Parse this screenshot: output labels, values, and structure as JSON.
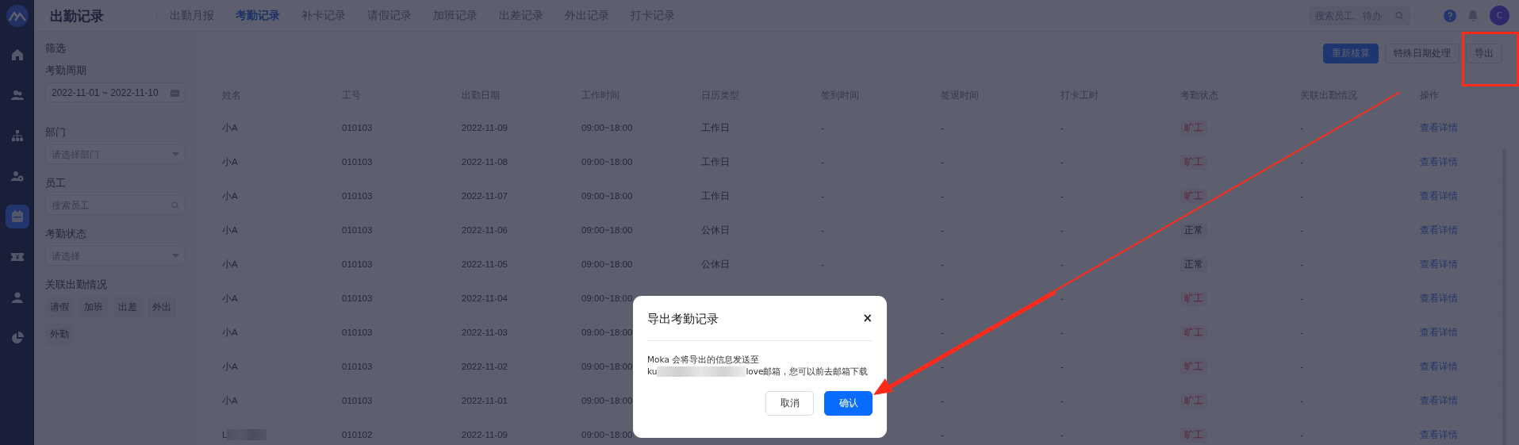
{
  "app": {
    "title": "出勤记录"
  },
  "nav_tabs": [
    {
      "label": "出勤月报",
      "selected": false
    },
    {
      "label": "考勤记录",
      "selected": true
    },
    {
      "label": "补卡记录",
      "selected": false
    },
    {
      "label": "请假记录",
      "selected": false
    },
    {
      "label": "加班记录",
      "selected": false
    },
    {
      "label": "出差记录",
      "selected": false
    },
    {
      "label": "外出记录",
      "selected": false
    },
    {
      "label": "打卡记录",
      "selected": false
    }
  ],
  "header": {
    "search": {
      "placeholder": "搜索员工、待办"
    },
    "avatar": "C"
  },
  "sidebar": {
    "items": [
      {
        "kind": "home",
        "selected": false
      },
      {
        "kind": "people",
        "selected": false
      },
      {
        "kind": "org",
        "selected": false
      },
      {
        "kind": "user-gear",
        "selected": false
      },
      {
        "kind": "calendar",
        "selected": true
      },
      {
        "kind": "ticket",
        "selected": false
      },
      {
        "kind": "person",
        "selected": false
      },
      {
        "kind": "pie",
        "selected": false
      }
    ]
  },
  "filter": {
    "title": "筛选",
    "fields": [
      {
        "label": "考勤周期",
        "kind": "date",
        "value": "2022-11-01 ~ 2022-11-10"
      },
      {
        "label": "部门",
        "kind": "select",
        "placeholder": "请选择部门"
      },
      {
        "label": "员工",
        "kind": "search",
        "placeholder": "搜索员工"
      },
      {
        "label": "考勤状态",
        "kind": "select",
        "placeholder": "请选择"
      }
    ],
    "related": {
      "label": "关联出勤情况",
      "chips": [
        "请假",
        "加班",
        "出差",
        "外出",
        "外勤"
      ]
    }
  },
  "toolbar": {
    "buttons": [
      {
        "label": "重新核算",
        "kind": "primary"
      },
      {
        "label": "特殊日期处理",
        "kind": "default"
      },
      {
        "label": "导出",
        "kind": "default"
      }
    ]
  },
  "table": {
    "columns": [
      "姓名",
      "工号",
      "出勤日期",
      "工作时间",
      "日历类型",
      "签到时间",
      "签退时间",
      "打卡工时",
      "考勤状态",
      "关联出勤情况",
      "操作"
    ],
    "rows": [
      {
        "name": "小A",
        "id": "010103",
        "date": "2022-11-09",
        "hours": "09:00~18:00",
        "calendar": "工作日",
        "sign_in": "-",
        "sign_out": "-",
        "punch_hours": "-",
        "status": {
          "label": "旷工",
          "kind": "absent"
        },
        "related": "-",
        "action": "查看详情"
      },
      {
        "name": "小A",
        "id": "010103",
        "date": "2022-11-08",
        "hours": "09:00~18:00",
        "calendar": "工作日",
        "sign_in": "-",
        "sign_out": "-",
        "punch_hours": "-",
        "status": {
          "label": "旷工",
          "kind": "absent"
        },
        "related": "-",
        "action": "查看详情"
      },
      {
        "name": "小A",
        "id": "010103",
        "date": "2022-11-07",
        "hours": "09:00~18:00",
        "calendar": "工作日",
        "sign_in": "-",
        "sign_out": "-",
        "punch_hours": "-",
        "status": {
          "label": "旷工",
          "kind": "absent"
        },
        "related": "-",
        "action": "查看详情"
      },
      {
        "name": "小A",
        "id": "010103",
        "date": "2022-11-06",
        "hours": "09:00~18:00",
        "calendar": "公休日",
        "sign_in": "-",
        "sign_out": "-",
        "punch_hours": "-",
        "status": {
          "label": "正常",
          "kind": "normal"
        },
        "related": "-",
        "action": "查看详情"
      },
      {
        "name": "小A",
        "id": "010103",
        "date": "2022-11-05",
        "hours": "09:00~18:00",
        "calendar": "公休日",
        "sign_in": "-",
        "sign_out": "-",
        "punch_hours": "-",
        "status": {
          "label": "正常",
          "kind": "normal"
        },
        "related": "-",
        "action": "查看详情"
      },
      {
        "name": "小A",
        "id": "010103",
        "date": "2022-11-04",
        "hours": "09:00~18:00",
        "sign_out": "-",
        "punch_hours": "-",
        "status": {
          "label": "旷工",
          "kind": "absent"
        },
        "related": "-",
        "action": "查看详情"
      },
      {
        "name": "小A",
        "id": "010103",
        "date": "2022-11-03",
        "hours": "09:00~18:00",
        "sign_out": "-",
        "punch_hours": "-",
        "status": {
          "label": "旷工",
          "kind": "absent"
        },
        "related": "-",
        "action": "查看详情"
      },
      {
        "name": "小A",
        "id": "010103",
        "date": "2022-11-02",
        "hours": "09:00~18:00",
        "sign_out": "-",
        "punch_hours": "-",
        "status": {
          "label": "旷工",
          "kind": "absent"
        },
        "related": "-",
        "action": "查看详情"
      },
      {
        "name": "小A",
        "id": "010103",
        "date": "2022-11-01",
        "hours": "09:00~18:00",
        "sign_out": "-",
        "punch_hours": "-",
        "status": {
          "label": "旷工",
          "kind": "absent"
        },
        "related": "-",
        "action": "查看详情"
      },
      {
        "name": "L",
        "id": "010102",
        "date": "2022-11-09",
        "hours": "09:00~18:00",
        "sign_out": "-",
        "punch_hours": "-",
        "status": {
          "label": "旷工",
          "kind": "absent"
        },
        "related": "-",
        "action": "查看详情",
        "redacted": true
      }
    ]
  },
  "dialog": {
    "title": "导出考勤记录",
    "close": "×",
    "message": "Moka 会将导出的信息发送至",
    "email_start": "ku",
    "email_end": "love邮箱，您可以前去邮箱下载",
    "buttons": [
      {
        "label": "取消",
        "kind": "default"
      },
      {
        "label": "确认",
        "kind": "primary"
      }
    ]
  }
}
